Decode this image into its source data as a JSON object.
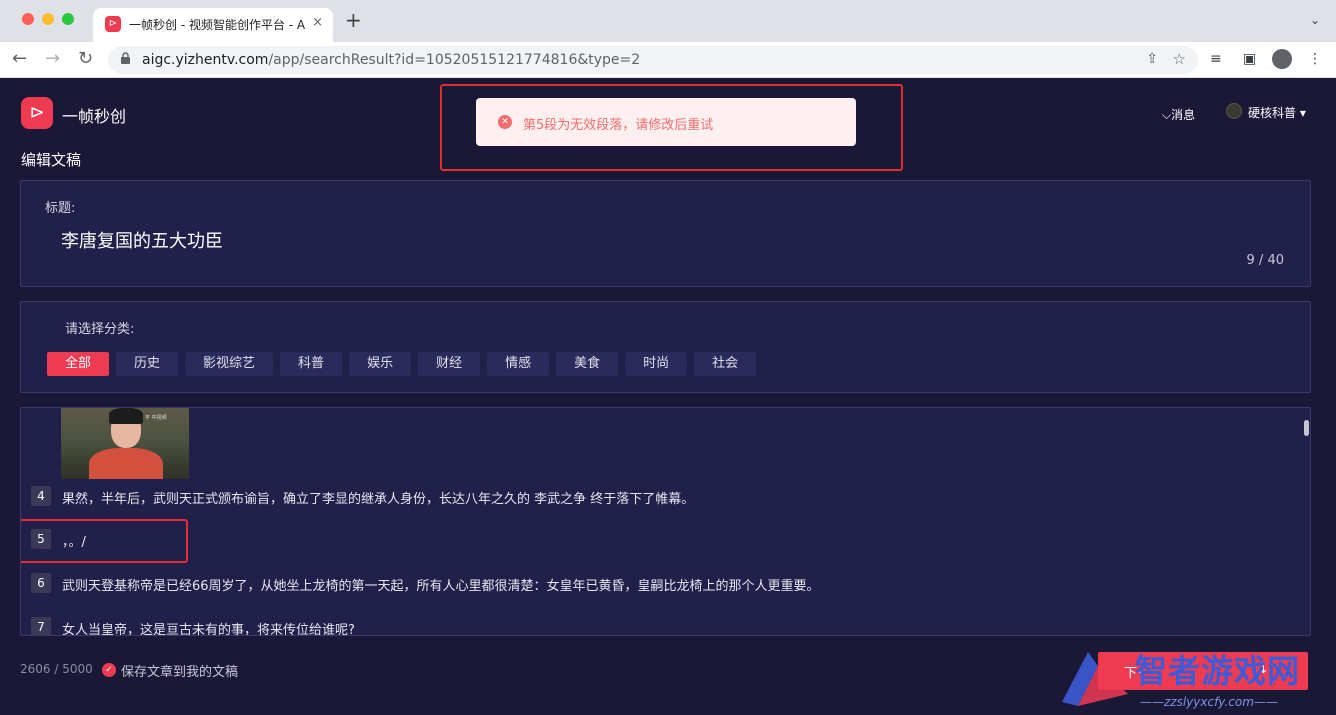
{
  "browser": {
    "tab_title": "一帧秒创 - 视频智能创作平台 - A",
    "tab_close": "×",
    "new_tab": "+",
    "tab_menu": "⌄",
    "url_domain": "aigc.yizhentv.com",
    "url_path": "/app/searchResult?id=10520515121774816&type=2",
    "icons": {
      "back": "←",
      "forward": "→",
      "reload": "↻",
      "lock": "🔒",
      "share": "⇪",
      "star": "☆",
      "media": "≡",
      "sidebar": "▣",
      "profile": "●",
      "menu": "⋮"
    }
  },
  "app": {
    "brand": "一帧秒创",
    "logo_glyph": "⊳",
    "page_title": "编辑文稿",
    "messages_label": "消息",
    "user_name": "硬核科普",
    "toast": {
      "icon": "✕",
      "message": "第5段为无效段落，请修改后重试"
    },
    "title_field": {
      "label": "标题:",
      "value": "李唐复国的五大功臣",
      "count": "9 / 40"
    },
    "category": {
      "label": "请选择分类:",
      "options": [
        "全部",
        "历史",
        "影视综艺",
        "科普",
        "娱乐",
        "财经",
        "情感",
        "美食",
        "时尚",
        "社会"
      ],
      "selected": "全部"
    },
    "thumbnail_caption": "平 中视频",
    "paragraphs": [
      {
        "num": "4",
        "text": "果然，半年后，武则天正式颁布谕旨，确立了李显的继承人身份，长达八年之久的 李武之争 终于落下了帷幕。"
      },
      {
        "num": "5",
        "text": "，。/"
      },
      {
        "num": "6",
        "text": "武则天登基称帝是已经66周岁了，从她坐上龙椅的第一天起，所有人心里都很清楚：女皇年已黄昏，皇嗣比龙椅上的那个人更重要。"
      },
      {
        "num": "7",
        "text": "女人当皇帝，这是亘古未有的事，将来传位给谁呢?"
      }
    ],
    "word_count": "2606 / 5000",
    "save_label": "保存文章到我的文稿",
    "next_btn_left": "下一",
    "next_btn_right": "↓"
  },
  "watermark": {
    "text": "智者游戏网",
    "url": "——zzslyyxcfy.com——"
  },
  "colors": {
    "accent": "#ee3b52",
    "background": "#1b1737",
    "card": "#21204a",
    "toast_bg": "#fef0f0",
    "toast_text": "#f56c6c",
    "highlight_outline": "#e02d2d"
  }
}
